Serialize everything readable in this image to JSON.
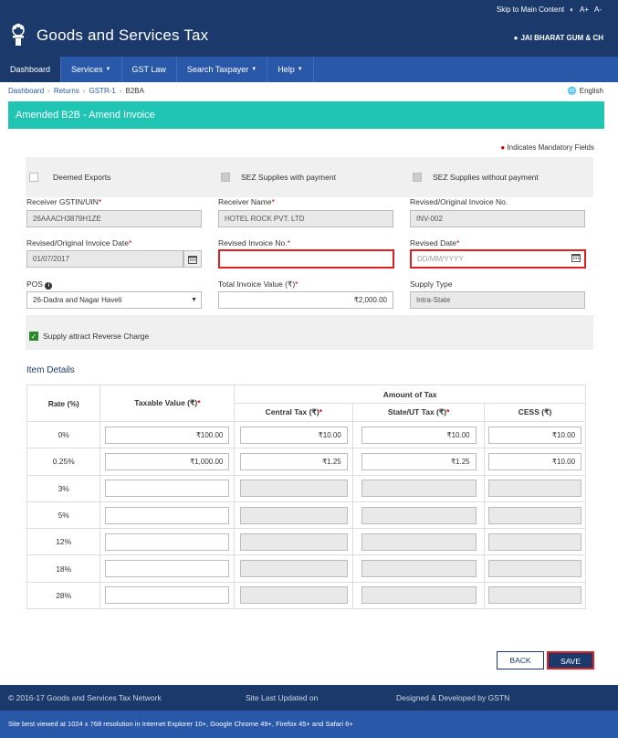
{
  "utility": {
    "skip": "Skip to Main Content",
    "contrast_icon": "contrast-icon",
    "font_up": "A+",
    "font_down": "A-"
  },
  "header": {
    "title": "Goods and Services Tax",
    "user": "JAI BHARAT GUM & CH"
  },
  "nav": [
    {
      "label": "Dashboard",
      "dropdown": false
    },
    {
      "label": "Services",
      "dropdown": true
    },
    {
      "label": "GST Law",
      "dropdown": false
    },
    {
      "label": "Search Taxpayer",
      "dropdown": true
    },
    {
      "label": "Help",
      "dropdown": true
    }
  ],
  "breadcrumb": {
    "items": [
      "Dashboard",
      "Returns",
      "GSTR-1"
    ],
    "current": "B2BA",
    "sep": "›"
  },
  "language": "English",
  "panel": {
    "title": "Amended B2B - Amend Invoice"
  },
  "mandatory_note": "Indicates Mandatory Fields",
  "checks": {
    "deemed": "Deemed Exports",
    "sez_pay": "SEZ Supplies with payment",
    "sez_nopay": "SEZ Supplies without payment",
    "reverse": "Supply attract Reverse Charge"
  },
  "fields": {
    "gstin_label": "Receiver GSTIN/UIN",
    "gstin_value": "26AAACH3879H1ZE",
    "name_label": "Receiver Name",
    "name_value": "HOTEL ROCK PVT. LTD",
    "orig_inv_label": "Revised/Original Invoice No.",
    "orig_inv_value": "INV-002",
    "orig_date_label": "Revised/Original Invoice Date",
    "orig_date_value": "01/07/2017",
    "rev_inv_label": "Revised Invoice No.",
    "rev_inv_value": "",
    "rev_date_label": "Revised Date",
    "rev_date_placeholder": "DD/MM/YYYY",
    "pos_label": "POS",
    "pos_value": "26-Dadra and Nagar Haveli",
    "total_label": "Total Invoice Value (₹)",
    "total_value": "₹2,000.00",
    "supply_label": "Supply Type",
    "supply_value": "Intra-State"
  },
  "items": {
    "title": "Item Details",
    "headers": {
      "rate": "Rate (%)",
      "taxable": "Taxable Value (₹)",
      "amount": "Amount of Tax",
      "central": "Central Tax (₹)",
      "state": "State/UT Tax (₹)",
      "cess": "CESS (₹)"
    },
    "rows": [
      {
        "rate": "0%",
        "taxable": "₹100.00",
        "central": "₹10.00",
        "state": "₹10.00",
        "cess": "₹10.00"
      },
      {
        "rate": "0.25%",
        "taxable": "₹1,000.00",
        "central": "₹1.25",
        "state": "₹1.25",
        "cess": "₹10.00"
      },
      {
        "rate": "3%",
        "taxable": "",
        "central": "",
        "state": "",
        "cess": ""
      },
      {
        "rate": "5%",
        "taxable": "",
        "central": "",
        "state": "",
        "cess": ""
      },
      {
        "rate": "12%",
        "taxable": "",
        "central": "",
        "state": "",
        "cess": ""
      },
      {
        "rate": "18%",
        "taxable": "",
        "central": "",
        "state": "",
        "cess": ""
      },
      {
        "rate": "28%",
        "taxable": "",
        "central": "",
        "state": "",
        "cess": ""
      }
    ]
  },
  "buttons": {
    "back": "BACK",
    "save": "SAVE"
  },
  "footer": {
    "copyright": "© 2016-17 Goods and Services Tax Network",
    "updated": "Site Last Updated on",
    "designed": "Designed & Developed by GSTN",
    "best_viewed": "Site best viewed at 1024 x 768 resolution in Internet Explorer 10+, Google Chrome 49+, Firefox 45+ and Safari 6+"
  },
  "colors": {
    "navy": "#1b3a6b",
    "nav_blue": "#2a58a8",
    "teal": "#20c4b3",
    "error_red": "#e02020"
  }
}
